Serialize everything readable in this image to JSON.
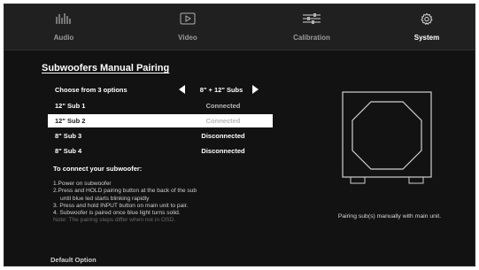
{
  "nav": {
    "tabs": [
      {
        "label": "Audio",
        "icon": "equalizer-icon"
      },
      {
        "label": "Video",
        "icon": "play-icon"
      },
      {
        "label": "Calibration",
        "icon": "sliders-icon"
      },
      {
        "label": "System",
        "icon": "gear-icon"
      }
    ],
    "active": "System"
  },
  "page": {
    "title": "Subwoofers Manual Pairing",
    "chooser": {
      "label": "Choose from 3 options",
      "value": "8\" + 12\" Subs"
    },
    "subs": [
      {
        "label": "12\" Sub 1",
        "status": "Connected"
      },
      {
        "label": "12\" Sub 2",
        "status": "Connected"
      },
      {
        "label": "8\" Sub 3",
        "status": "Disconnected"
      },
      {
        "label": "8\" Sub 4",
        "status": "Disconnected"
      }
    ],
    "selected_index": 1,
    "instructions_title": "To connect your subwoofer:",
    "steps": [
      "1.Power on subwoofer",
      "2.Press and HOLD pairing button at the back of the sub",
      "until blue led starts blinking rapidly",
      "3. Press and hold INPUT button on main unit to pair.",
      "4. Subwoofer is paired once blue light turns solid."
    ],
    "note": "Note: The pairing steps differ when not in OSD.",
    "caption": "Pairing sub(s) manually with main unit.",
    "footer": "Default Option"
  },
  "colors": {
    "background": "#121212",
    "nav_background": "#202020",
    "selected_row": "#ffffff",
    "text": "#ffffff",
    "muted": "#9a9a9a"
  }
}
